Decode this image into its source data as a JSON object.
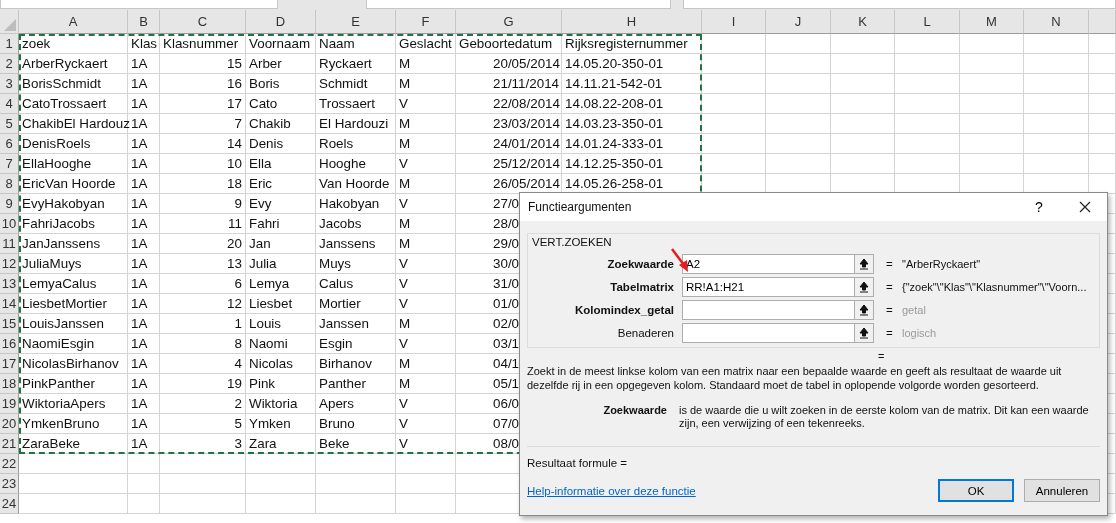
{
  "columns": [
    "A",
    "B",
    "C",
    "D",
    "E",
    "F",
    "G",
    "H",
    "I",
    "J",
    "K",
    "L",
    "M",
    "N"
  ],
  "rows": [
    {
      "number": "1",
      "cells": [
        "zoek",
        "Klas",
        "Klasnummer",
        "Voornaam",
        "Naam",
        "Geslacht",
        "Geboortedatum",
        "Rijksregisternummer"
      ]
    },
    {
      "number": "2",
      "cells": [
        "ArberRyckaert",
        "1A",
        "15",
        "Arber",
        "Ryckaert",
        "M",
        "20/05/2014",
        "14.05.20-350-01"
      ]
    },
    {
      "number": "3",
      "cells": [
        "BorisSchmidt",
        "1A",
        "16",
        "Boris",
        "Schmidt",
        "M",
        "21/11/2014",
        "14.11.21-542-01"
      ]
    },
    {
      "number": "4",
      "cells": [
        "CatoTrossaert",
        "1A",
        "17",
        "Cato",
        "Trossaert",
        "V",
        "22/08/2014",
        "14.08.22-208-01"
      ]
    },
    {
      "number": "5",
      "cells": [
        "ChakibEl Hardouz",
        "1A",
        "7",
        "Chakib",
        "El Hardouzi",
        "M",
        "23/03/2014",
        "14.03.23-350-01"
      ]
    },
    {
      "number": "6",
      "cells": [
        "DenisRoels",
        "1A",
        "14",
        "Denis",
        "Roels",
        "M",
        "24/01/2014",
        "14.01.24-333-01"
      ]
    },
    {
      "number": "7",
      "cells": [
        "EllaHooghe",
        "1A",
        "10",
        "Ella",
        "Hooghe",
        "V",
        "25/12/2014",
        "14.12.25-350-01"
      ]
    },
    {
      "number": "8",
      "cells": [
        "EricVan Hoorde",
        "1A",
        "18",
        "Eric",
        "Van Hoorde",
        "M",
        "26/05/2014",
        "14.05.26-258-01"
      ]
    },
    {
      "number": "9",
      "cells": [
        "EvyHakobyan",
        "1A",
        "9",
        "Evy",
        "Hakobyan",
        "V",
        "27/0",
        ""
      ]
    },
    {
      "number": "10",
      "cells": [
        "FahriJacobs",
        "1A",
        "11",
        "Fahri",
        "Jacobs",
        "M",
        "28/0",
        ""
      ]
    },
    {
      "number": "11",
      "cells": [
        "JanJanssens",
        "1A",
        "20",
        "Jan",
        "Janssens",
        "M",
        "29/0",
        ""
      ]
    },
    {
      "number": "12",
      "cells": [
        "JuliaMuys",
        "1A",
        "13",
        "Julia",
        "Muys",
        "V",
        "30/0",
        ""
      ]
    },
    {
      "number": "13",
      "cells": [
        "LemyaCalus",
        "1A",
        "6",
        "Lemya",
        "Calus",
        "V",
        "31/0",
        ""
      ]
    },
    {
      "number": "14",
      "cells": [
        "LiesbetMortier",
        "1A",
        "12",
        "Liesbet",
        "Mortier",
        "V",
        "01/0",
        ""
      ]
    },
    {
      "number": "15",
      "cells": [
        "LouisJanssen",
        "1A",
        "1",
        "Louis",
        "Janssen",
        "M",
        "02/0",
        ""
      ]
    },
    {
      "number": "16",
      "cells": [
        "NaomiEsgin",
        "1A",
        "8",
        "Naomi",
        "Esgin",
        "V",
        "03/1",
        ""
      ]
    },
    {
      "number": "17",
      "cells": [
        "NicolasBirhanov",
        "1A",
        "4",
        "Nicolas",
        "Birhanov",
        "M",
        "04/1",
        ""
      ]
    },
    {
      "number": "18",
      "cells": [
        "PinkPanther",
        "1A",
        "19",
        "Pink",
        "Panther",
        "M",
        "05/1",
        ""
      ]
    },
    {
      "number": "19",
      "cells": [
        "WiktoriaApers",
        "1A",
        "2",
        "Wiktoria",
        "Apers",
        "V",
        "06/0",
        ""
      ]
    },
    {
      "number": "20",
      "cells": [
        "YmkenBruno",
        "1A",
        "5",
        "Ymken",
        "Bruno",
        "V",
        "07/0",
        ""
      ]
    },
    {
      "number": "21",
      "cells": [
        "ZaraBeke",
        "1A",
        "3",
        "Zara",
        "Beke",
        "V",
        "08/0",
        ""
      ]
    },
    {
      "number": "22",
      "cells": []
    },
    {
      "number": "23",
      "cells": []
    },
    {
      "number": "24",
      "cells": []
    }
  ],
  "dialog": {
    "title": "Functieargumenten",
    "help_button": "?",
    "function_name": "VERT.ZOEKEN",
    "arguments": [
      {
        "label": "Zoekwaarde",
        "value": "A2",
        "equals": "=",
        "result": "\"ArberRyckaert\"",
        "required": true,
        "hint": false
      },
      {
        "label": "Tabelmatrix",
        "value": "RR!A1:H21",
        "equals": "=",
        "result": "{\"zoek\"\\\"Klas\"\\\"Klasnummer\"\\\"Voorn...",
        "required": true,
        "hint": false
      },
      {
        "label": "Kolomindex_getal",
        "equals": "=",
        "result": "getal",
        "required": true,
        "hint": true
      },
      {
        "label": "Benaderen",
        "equals": "=",
        "result": "logisch",
        "required": false,
        "hint": true
      }
    ],
    "overall_equals": "=",
    "description": "Zoekt in de meest linkse kolom van een matrix naar een bepaalde waarde en geeft als resultaat de waarde uit dezelfde rij in een opgegeven kolom. Standaard moet de tabel in oplopende volgorde worden gesorteerd.",
    "argument_help": {
      "name": "Zoekwaarde",
      "text": "is de waarde die u wilt zoeken in de eerste kolom van de matrix. Dit kan een waarde zijn, een verwijzing of een tekenreeks."
    },
    "formula_result": "Resultaat formule =",
    "help_link": "Help-informatie over deze functie",
    "buttons": [
      {
        "label": "OK",
        "default": true
      },
      {
        "label": "Annuleren",
        "default": false
      }
    ]
  }
}
